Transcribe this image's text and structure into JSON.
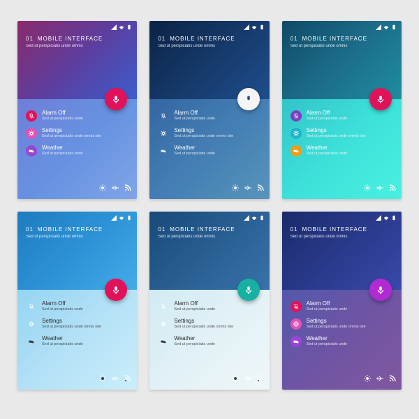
{
  "header": {
    "num": "01",
    "title": "MOBILE INTERFACE",
    "sub": "Sed ut perspiciatis unde omnis"
  },
  "items": [
    {
      "label": "Alarm Off",
      "sub": "Sed ut perspiciatis unde"
    },
    {
      "label": "Settings",
      "sub": "Sed ut perspiciatis unde omnis iste"
    },
    {
      "label": "Weather",
      "sub": "Sed ut perspiciatis unde"
    }
  ],
  "fab_icon": "mic-icon",
  "status_icons": [
    "signal-icon",
    "wifi-icon",
    "battery-icon"
  ],
  "footer_icons": [
    "brightness-icon",
    "airplane-icon",
    "rss-icon"
  ],
  "palettes": [
    "p1",
    "p2",
    "p3",
    "p4",
    "p5",
    "p6"
  ]
}
